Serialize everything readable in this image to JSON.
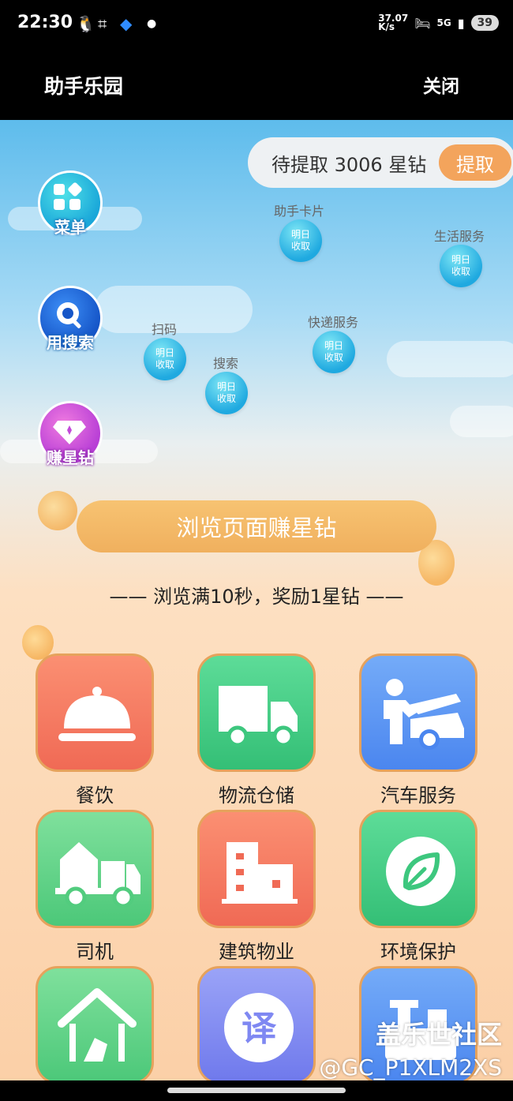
{
  "status_bar": {
    "time": "22:30",
    "net_speed": "37.07\nK/s",
    "signal": "5G",
    "battery": "39"
  },
  "titlebar": {
    "title": "助手乐园",
    "close_label": "关闭"
  },
  "pending": {
    "text": "待提取 3006 星钻",
    "button": "提取"
  },
  "side_buttons": [
    {
      "label": "菜单",
      "icon": "grid-icon"
    },
    {
      "label": "用搜索",
      "icon": "search-icon"
    },
    {
      "label": "赚星钻",
      "icon": "diamond-icon"
    }
  ],
  "bubbles": [
    {
      "label": "助手卡片",
      "text": "明日\n收取"
    },
    {
      "label": "生活服务",
      "text": "明日\n收取"
    },
    {
      "label": "扫码",
      "text": "明日\n收取"
    },
    {
      "label": "快递服务",
      "text": "明日\n收取"
    },
    {
      "label": "搜索",
      "text": "明日\n收取"
    }
  ],
  "browse": {
    "button": "浏览页面赚星钻",
    "reward": "—— 浏览满10秒，奖励1星钻 ——"
  },
  "tiles": [
    {
      "label": "餐饮",
      "icon": "food-cloche-icon",
      "color": "#f77b62"
    },
    {
      "label": "物流仓储",
      "icon": "truck-icon",
      "color": "#4fd08d"
    },
    {
      "label": "汽车服务",
      "icon": "car-repair-icon",
      "color": "#5d98f5"
    },
    {
      "label": "司机",
      "icon": "moving-truck-icon",
      "color": "#62d58c"
    },
    {
      "label": "建筑物业",
      "icon": "building-icon",
      "color": "#f77b62"
    },
    {
      "label": "环境保护",
      "icon": "leaf-icon",
      "color": "#4fd08d"
    },
    {
      "label": "",
      "icon": "house-cleaning-icon",
      "color": "#62d58c"
    },
    {
      "label": "",
      "icon": "translate-icon",
      "color": "#7f88f2"
    },
    {
      "label": "",
      "icon": "machine-icon",
      "color": "#5d98f5"
    }
  ],
  "watermark": {
    "line1": "盖乐世社区",
    "line2": "@GC_P1XLM2XS"
  }
}
